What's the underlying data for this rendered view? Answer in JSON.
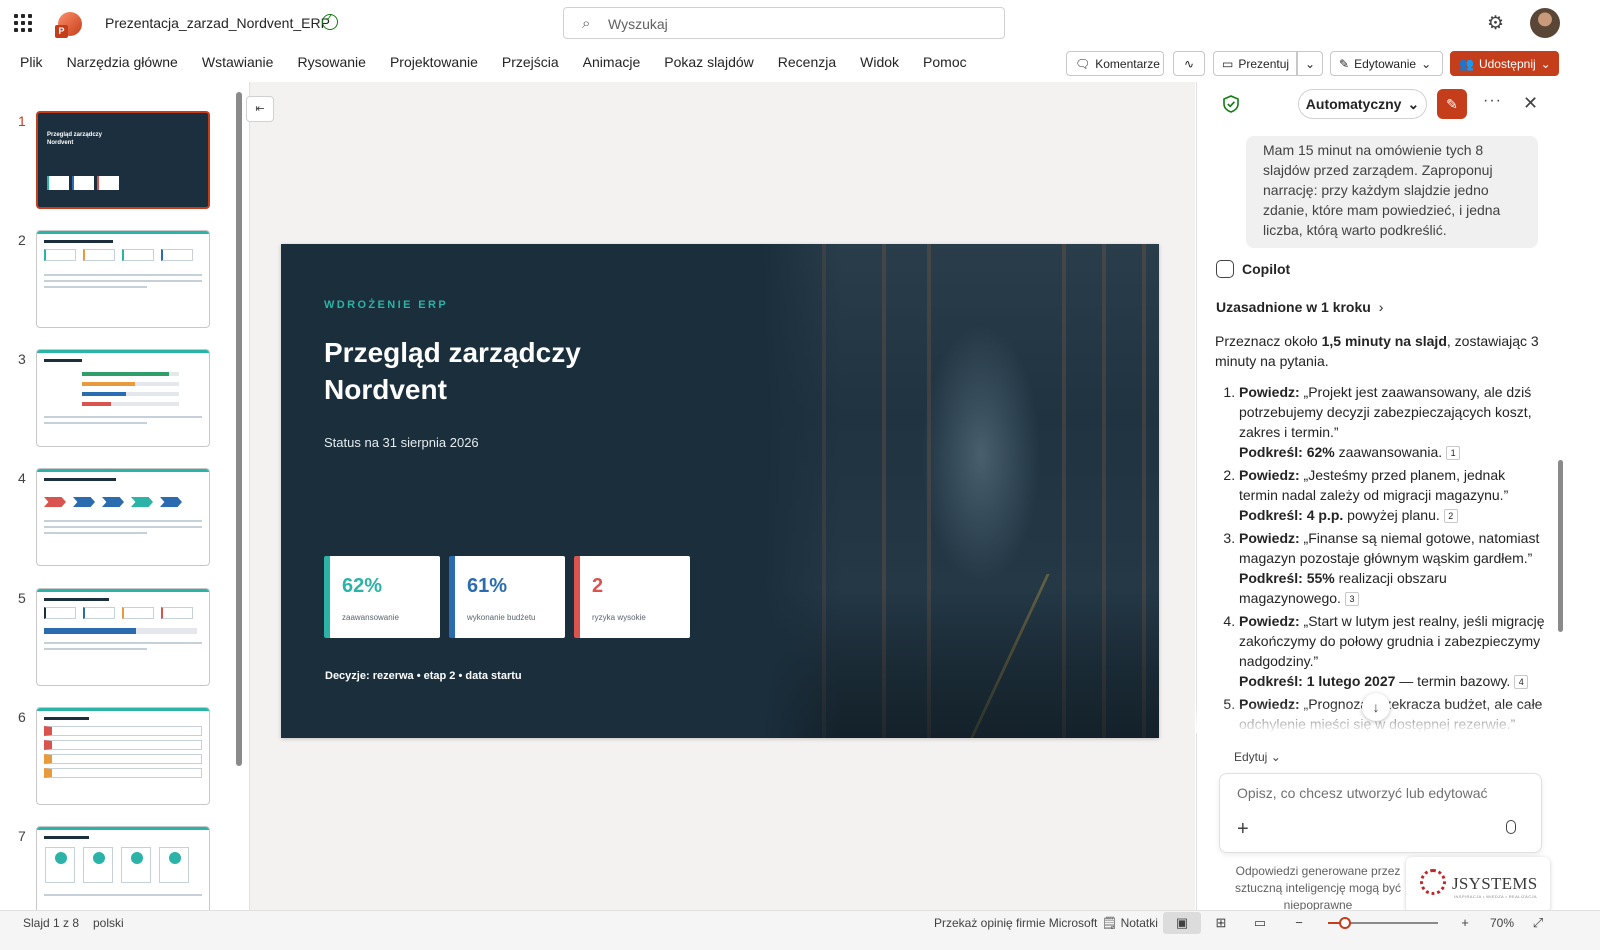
{
  "app": {
    "doc_title": "Prezentacja_zarzad_Nordvent_ERP",
    "search_placeholder": "Wyszukaj"
  },
  "ribbon": {
    "tabs": [
      "Plik",
      "Narzędzia główne",
      "Wstawianie",
      "Rysowanie",
      "Projektowanie",
      "Przejścia",
      "Animacje",
      "Pokaz slajdów",
      "Recenzja",
      "Widok",
      "Pomoc"
    ],
    "comments_label": "Komentarze",
    "present_label": "Prezentuj",
    "editing_label": "Edytowanie",
    "share_label": "Udostępnij"
  },
  "thumbnails": {
    "numbers": [
      "1",
      "2",
      "3",
      "4",
      "5",
      "6",
      "7"
    ],
    "active_index": 0
  },
  "slide": {
    "kicker": "WDROŻENIE ERP",
    "title_line1": "Przegląd zarządczy",
    "title_line2": "Nordvent",
    "subtitle": "Status na 31 sierpnia 2026",
    "kpis": [
      {
        "value": "62%",
        "label": "zaawansowanie",
        "color": "#2ab3a6"
      },
      {
        "value": "61%",
        "label": "wykonanie budżetu",
        "color": "#2b6cb0"
      },
      {
        "value": "2",
        "label": "ryzyka wysokie",
        "color": "#d9534f"
      }
    ],
    "decisions": "Decyzje: rezerwa • etap 2 • data startu"
  },
  "copilot": {
    "mode_label": "Automatyczny",
    "user_message": "Mam 15 minut na omówienie tych 8 slajdów przed zarządem. Zaproponuj narrację: przy każdym slajdzie jedno zdanie, które mam powiedzieć, i jedna liczba, którą warto podkreślić.",
    "assistant_name": "Copilot",
    "grounded_label": "Uzasadnione w 1 kroku",
    "intro_prefix": "Przeznacz około ",
    "intro_bold": "1,5 minuty na slajd",
    "intro_suffix": ", zostawiając 3 minuty na pytania.",
    "say_label": "Powiedz:",
    "emphasize_label": "Podkreśl:",
    "items": [
      {
        "say": " „Projekt jest zaawansowany, ale dziś potrzebujemy decyzji zabezpieczających koszt, zakres i termin.”",
        "emph_bold": " 62%",
        "emph_rest": " zaawansowania.",
        "ref": "1"
      },
      {
        "say": " „Jesteśmy przed planem, jednak termin nadal zależy od migracji magazynu.”",
        "emph_bold": " 4 p.p.",
        "emph_rest": " powyżej planu.",
        "ref": "2"
      },
      {
        "say": " „Finanse są niemal gotowe, natomiast magazyn pozostaje głównym wąskim gardłem.”",
        "emph_bold": " 55%",
        "emph_rest": " realizacji obszaru magazynowego.",
        "ref": "3"
      },
      {
        "say": " „Start w lutym jest realny, jeśli migrację zakończymy do połowy grudnia i zabezpieczymy nadgodziny.”",
        "emph_bold": " 1 lutego 2027",
        "emph_rest": " — termin bazowy.",
        "ref": "4"
      },
      {
        "say": " „Prognoza przekracza budżet, ale całe odchylenie mieści się w dostępnej rezerwie.”",
        "emph_bold": "",
        "emph_rest": "",
        "ref": ""
      }
    ],
    "edit_label": "Edytuj",
    "composer_placeholder": "Opisz, co chcesz utworzyć lub edytować",
    "disclaimer": "Odpowiedzi generowane przez sztuczną inteligencję mogą być niepoprawne",
    "watermark_text": "JSYSTEMS",
    "watermark_tag": "INSPIRACJA • WIEDZA • REALIZACJA"
  },
  "statusbar": {
    "slide_counter": "Slajd 1 z 8",
    "language": "polski",
    "feedback": "Przekaż opinię firmie Microsoft",
    "notes": "Notatki",
    "zoom": "70%",
    "zoom_fraction": 0.15
  }
}
